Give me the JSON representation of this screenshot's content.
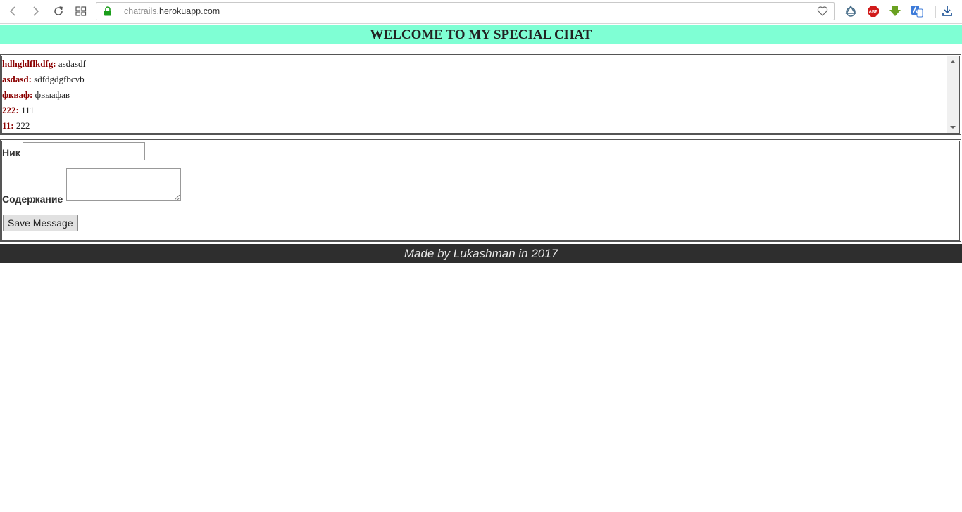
{
  "browser": {
    "url_sub": "chatrails.",
    "url_domain": "herokuapp.com",
    "icons": {
      "back": "chevron-left-icon",
      "forward": "chevron-right-icon",
      "reload": "reload-icon",
      "speed_dial": "grid-icon",
      "secure": "lock-icon",
      "bookmark": "heart-icon",
      "ext1": "opera-vpn-icon",
      "ext2": "adblock-plus-icon",
      "ext3": "download-arrow-icon",
      "ext4": "translate-icon",
      "downloads": "download-icon"
    },
    "adblock_label": "ABP"
  },
  "page": {
    "title": "WELCOME TO MY SPECIAL CHAT",
    "header_color": "#7fffd4",
    "nick_color": "#8b0000"
  },
  "messages": [
    {
      "nick": "hdhgldflkdfg:",
      "text": "asdasdf"
    },
    {
      "nick": "asdasd:",
      "text": "sdfdgdgfbcvb"
    },
    {
      "nick": "фкваф:",
      "text": "фвыафав"
    },
    {
      "nick": "222:",
      "text": "111"
    },
    {
      "nick": "11:",
      "text": "222"
    }
  ],
  "form": {
    "nick_label": "Ник",
    "nick_value": "",
    "content_label": "Содержание",
    "content_value": "",
    "submit_label": "Save Message"
  },
  "footer": {
    "text": "Made by Lukashman in 2017"
  }
}
